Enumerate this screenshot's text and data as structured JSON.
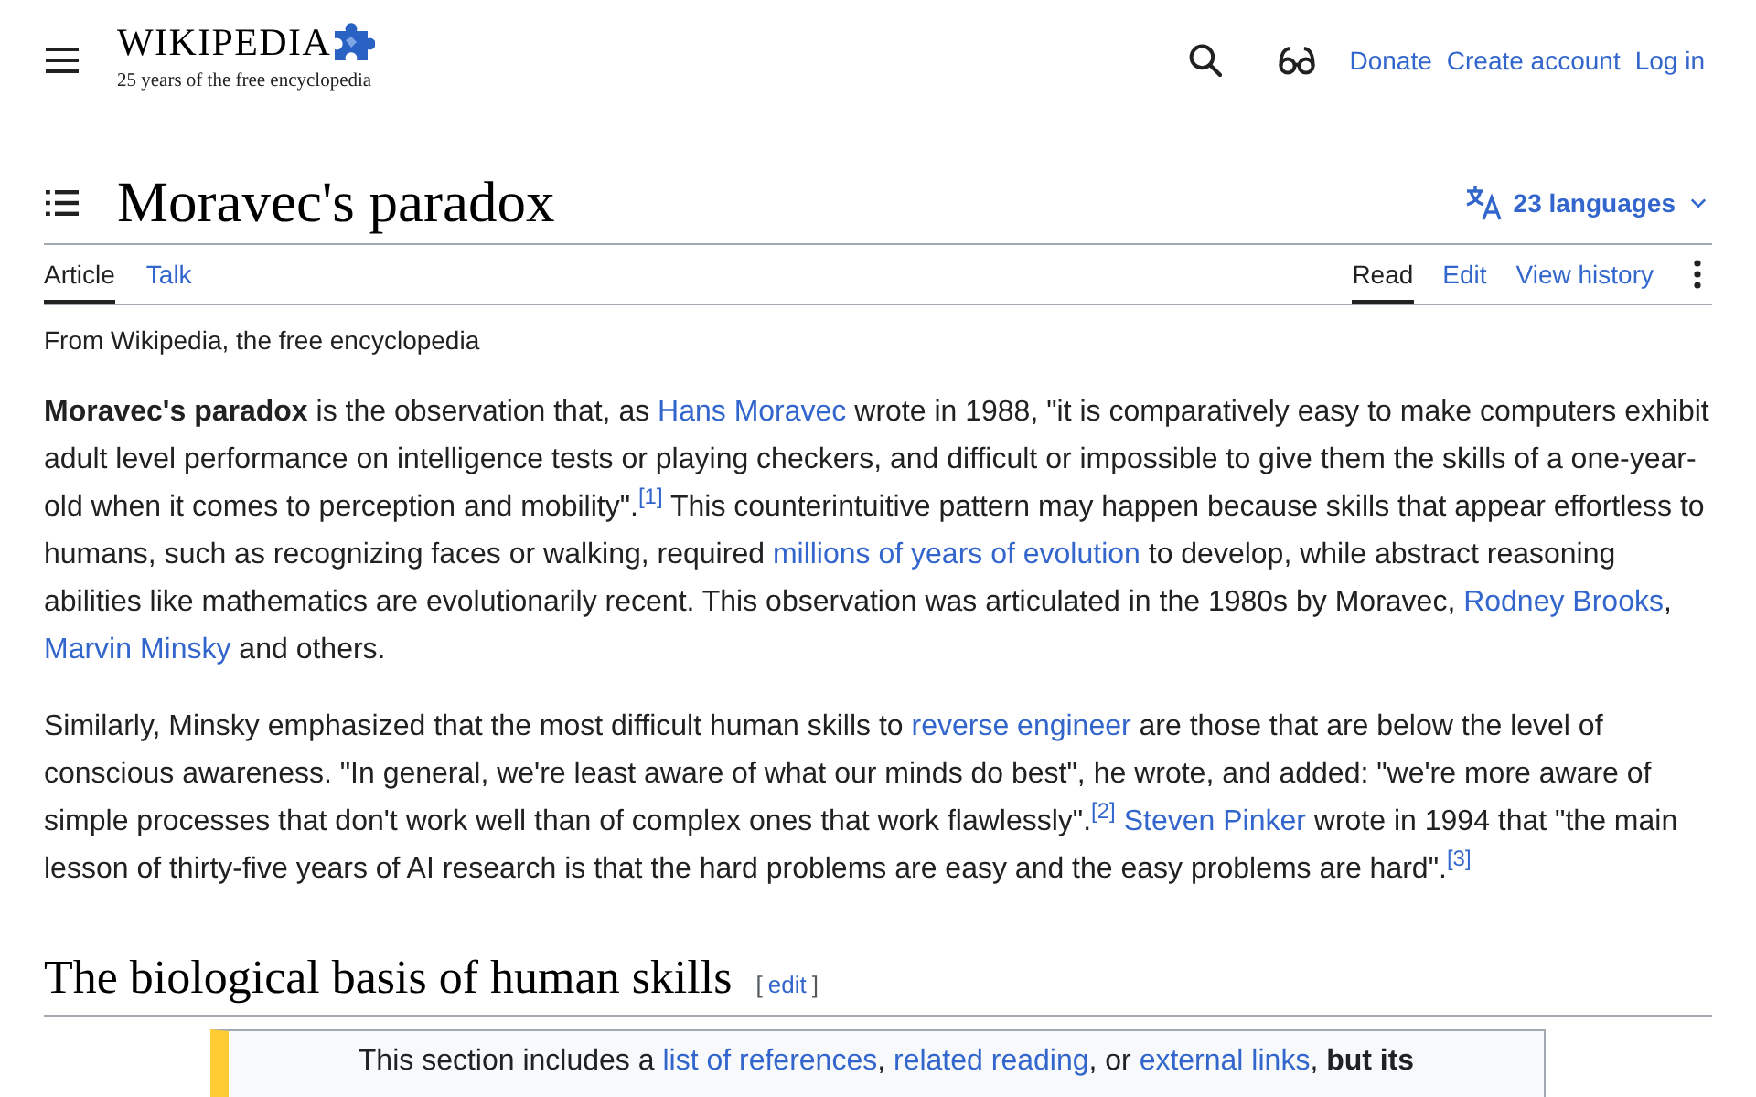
{
  "header": {
    "wordmark": "WIKIPEDIA",
    "tagline": "25 years of the free encyclopedia",
    "links": [
      {
        "label": "Donate"
      },
      {
        "label": "Create account"
      },
      {
        "label": "Log in"
      }
    ]
  },
  "article": {
    "title": "Moravec's paradox",
    "languages": {
      "label": "23 languages"
    },
    "tabs_left": [
      {
        "label": "Article",
        "selected": true
      },
      {
        "label": "Talk",
        "selected": false
      }
    ],
    "tabs_right": [
      {
        "label": "Read",
        "selected": true
      },
      {
        "label": "Edit",
        "selected": false
      },
      {
        "label": "View history",
        "selected": false
      }
    ],
    "subtitle": "From Wikipedia, the free encyclopedia",
    "paragraphs": [
      {
        "segments": [
          {
            "kind": "text",
            "text": "**Moravec's paradox** is the observation that, as "
          },
          {
            "kind": "link",
            "text": "Hans Moravec"
          },
          {
            "kind": "text",
            "text": " wrote in 1988, \"it is comparatively easy to make computers exhibit adult level performance on intelligence tests or playing checkers, and difficult or impossible to give them the skills of a one-year-old when it comes to perception and mobility\".$^{[1]}$ This counterintuitive pattern may happen because skills that appear effortless to humans, such as recognizing faces or walking, required "
          },
          {
            "kind": "link",
            "text": "millions of years of evolution"
          },
          {
            "kind": "text",
            "text": " to develop, while abstract reasoning abilities like mathematics are evolutionarily recent. This observation was articulated in the 1980s by Moravec, "
          },
          {
            "kind": "link",
            "text": "Rodney Brooks"
          },
          {
            "kind": "text",
            "text": ", "
          },
          {
            "kind": "link",
            "text": "Marvin Minsky"
          },
          {
            "kind": "text",
            "text": " and others."
          }
        ]
      },
      {
        "segments": [
          {
            "kind": "text",
            "text": "Similarly, Minsky emphasized that the most difficult human skills to "
          },
          {
            "kind": "link",
            "text": "reverse engineer"
          },
          {
            "kind": "text",
            "text": " are those that are below the level of conscious awareness. \"In general, we're least aware of what our minds do best\", he wrote, and added: \"we're more aware of simple processes that don't work well than of complex ones that work flawlessly\".$^{[2]}$ "
          },
          {
            "kind": "link",
            "text": "Steven Pinker"
          },
          {
            "kind": "text",
            "text": " wrote in 1994 that \"the main lesson of thirty-five years of AI research is that the hard problems are easy and the easy problems are hard\".$^{[3]}$"
          }
        ]
      }
    ],
    "section": {
      "heading": "The biological basis of human skills",
      "edit_link": {
        "brackets": [
          "[",
          "]"
        ],
        "label": "edit"
      },
      "notice": {
        "segments": [
          {
            "kind": "text",
            "text": "This section includes a "
          },
          {
            "kind": "link",
            "text": "list of references"
          },
          {
            "kind": "text",
            "text": ", "
          },
          {
            "kind": "link",
            "text": "related reading"
          },
          {
            "kind": "text",
            "text": ", or "
          },
          {
            "kind": "link",
            "text": "external links"
          },
          {
            "kind": "text",
            "text": ", **but its**"
          }
        ]
      }
    }
  }
}
